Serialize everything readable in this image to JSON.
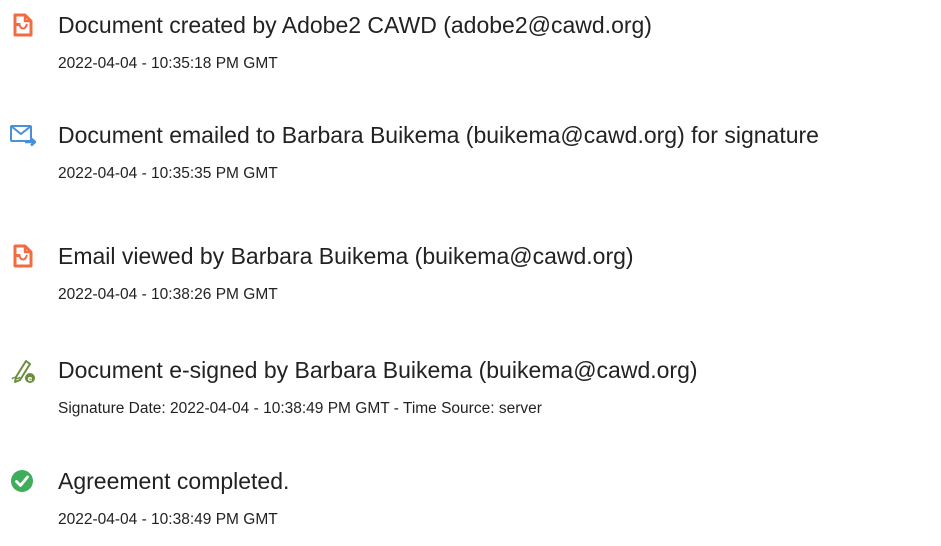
{
  "events": [
    {
      "icon": "document-icon",
      "title": "Document created by Adobe2 CAWD (adobe2@cawd.org)",
      "meta": "2022-04-04 - 10:35:18 PM GMT"
    },
    {
      "icon": "email-send-icon",
      "title": "Document emailed to Barbara Buikema (buikema@cawd.org) for signature",
      "meta": "2022-04-04 - 10:35:35 PM GMT"
    },
    {
      "icon": "document-icon",
      "title": "Email viewed by Barbara Buikema (buikema@cawd.org)",
      "meta": "2022-04-04 - 10:38:26 PM GMT"
    },
    {
      "icon": "pen-signature-icon",
      "title": "Document e-signed by Barbara Buikema (buikema@cawd.org)",
      "meta": "Signature Date: 2022-04-04 - 10:38:49 PM GMT - Time Source: server"
    },
    {
      "icon": "check-circle-icon",
      "title": "Agreement completed.",
      "meta": "2022-04-04 - 10:38:49 PM GMT"
    }
  ],
  "colors": {
    "document_icon": "#F26B43",
    "email_icon": "#4A90D9",
    "pen_icon": "#6B8E3D",
    "check_icon": "#3FAE5A"
  }
}
